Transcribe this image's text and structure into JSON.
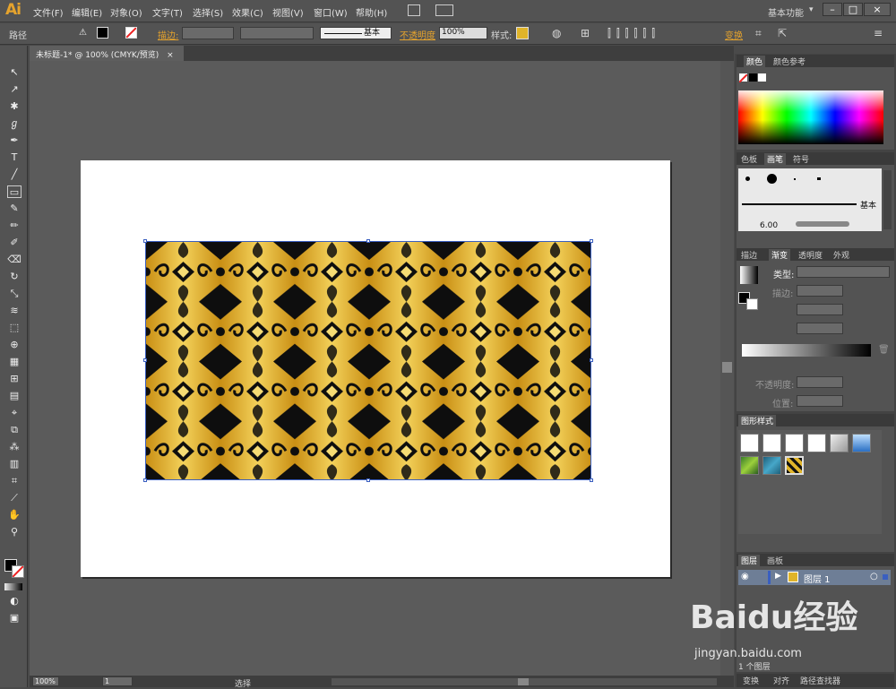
{
  "app": {
    "logo": "Ai",
    "workspace": "基本功能",
    "workspace_arrow": "▾"
  },
  "menu": [
    "文件(F)",
    "编辑(E)",
    "对象(O)",
    "文字(T)",
    "选择(S)",
    "效果(C)",
    "视图(V)",
    "窗口(W)",
    "帮助(H)"
  ],
  "control": {
    "object_type": "路径",
    "stroke_label": "描边:",
    "stroke_profile": "基本",
    "opacity_label": "不透明度",
    "opacity_value": "100%",
    "style_label": "样式:",
    "transform_label": "变换"
  },
  "document": {
    "tab_title": "未标题-1* @ 100% (CMYK/预览)",
    "close": "×"
  },
  "status": {
    "zoom": "100%",
    "page": "1",
    "tool": "选择"
  },
  "panels": {
    "color": {
      "tabs": [
        "颜色",
        "颜色参考"
      ]
    },
    "brush": {
      "tabs": [
        "色板",
        "画笔",
        "符号"
      ],
      "basic_label": "基本",
      "size_label": "6.00"
    },
    "gradient": {
      "tabs": [
        "描边",
        "渐变",
        "透明度",
        "外观"
      ],
      "type_label": "类型:",
      "stroke_label": "描边:",
      "opacity_label": "不透明度:",
      "position_label": "位置:"
    },
    "graphic_styles": {
      "tabs": [
        "图形样式"
      ]
    },
    "layers": {
      "tabs": [
        "图层",
        "画板"
      ],
      "layer_name": "图层 1",
      "count": "1 个图层"
    },
    "bottom": {
      "tabs": [
        "变换",
        "对齐",
        "路径查找器"
      ]
    }
  },
  "watermark": {
    "brand": "Baidu经验",
    "url": "jingyan.baidu.com"
  },
  "colors": {
    "gold": "#e0b42a",
    "dark": "#0e0e0e",
    "accent": "#e5a32d",
    "selection": "#3a5fc0"
  }
}
